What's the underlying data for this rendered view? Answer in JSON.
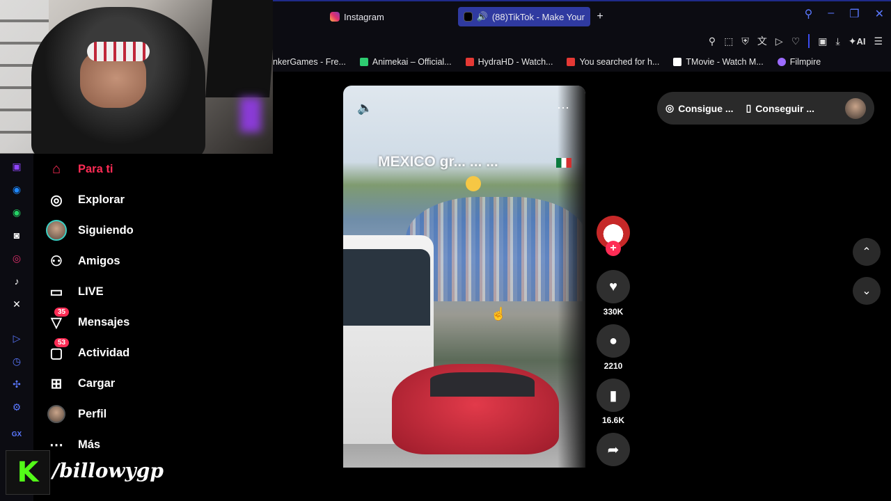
{
  "browser": {
    "tabs": [
      {
        "label": "Instagram"
      },
      {
        "label": "(88)TikTok - Make Your"
      }
    ],
    "new_tab": "+",
    "toolbar_ai": "AI",
    "bookmarks": [
      {
        "label": "nkerGames - Fre...",
        "color": "#5b7bff"
      },
      {
        "label": "Animekai – Official...",
        "color": "#2ecc71"
      },
      {
        "label": "HydraHD - Watch...",
        "color": "#e53935"
      },
      {
        "label": "You searched for h...",
        "color": "#e53935"
      },
      {
        "label": "TMovie - Watch M...",
        "color": "#ffffff"
      },
      {
        "label": "Filmpire",
        "color": "#9c6bff"
      }
    ],
    "sidebar_label_gx": "GX"
  },
  "tiktok": {
    "nav": [
      {
        "label": "Para ti",
        "icon": "home-icon"
      },
      {
        "label": "Explorar",
        "icon": "compass-icon"
      },
      {
        "label": "Siguiendo",
        "icon": "following-avatar"
      },
      {
        "label": "Amigos",
        "icon": "friends-icon"
      },
      {
        "label": "LIVE",
        "icon": "live-icon"
      },
      {
        "label": "Mensajes",
        "icon": "messages-icon",
        "badge": "35"
      },
      {
        "label": "Actividad",
        "icon": "activity-icon",
        "badge": "53"
      },
      {
        "label": "Cargar",
        "icon": "upload-icon"
      },
      {
        "label": "Perfil",
        "icon": "profile-avatar"
      },
      {
        "label": "Más",
        "icon": "more-icon"
      }
    ],
    "video": {
      "caption": "MEXICO gr... ... ...",
      "likes": "330K",
      "comments": "2210",
      "saves": "16.6K"
    },
    "pill": {
      "item1": "Consigue ...",
      "item2": "Conseguir ..."
    }
  },
  "overlay": {
    "kick_letter": "K",
    "handle": "/billowygp"
  },
  "colors": {
    "accent": "#fe2c55",
    "browser_accent": "#5a78ff",
    "kick_green": "#53fc18"
  }
}
